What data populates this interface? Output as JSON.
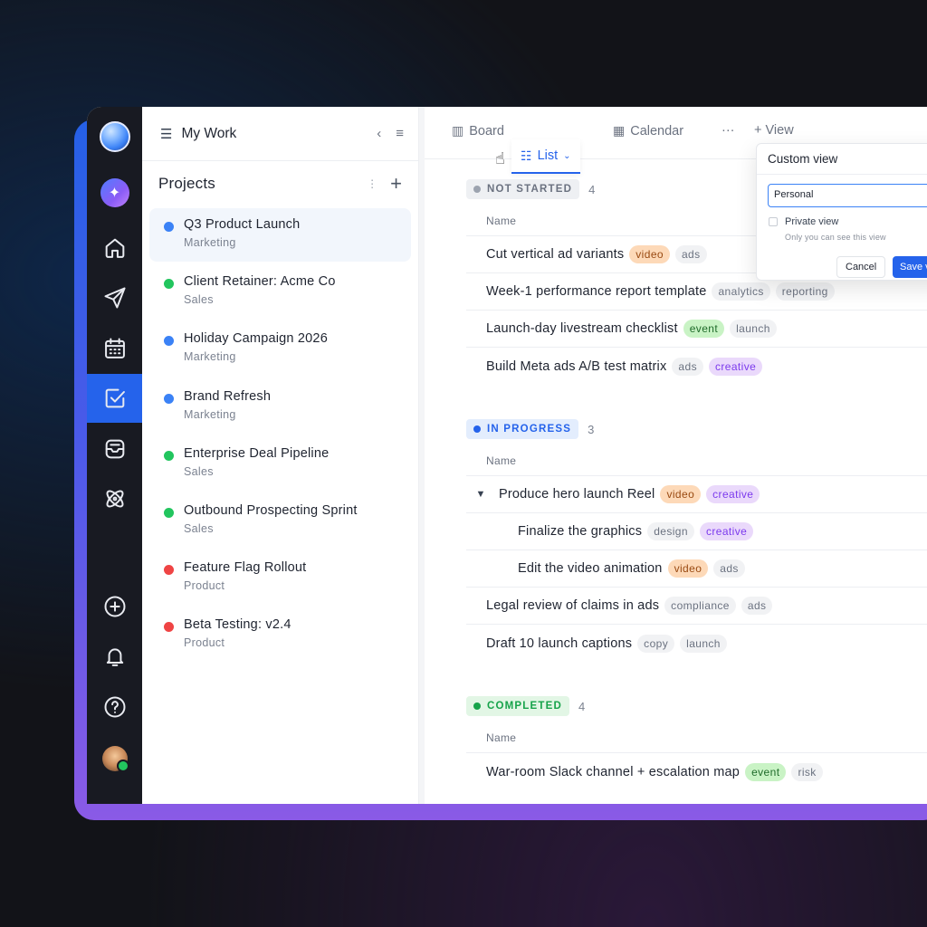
{
  "colors": {
    "accent": "#2563eb",
    "rail": "#181a22",
    "dot_blue": "#3b82f6",
    "dot_green": "#22c55e",
    "dot_red": "#ef4444"
  },
  "rail": {
    "icons": [
      "app-logo",
      "ai-sparkle-icon",
      "home-icon",
      "send-icon",
      "calendar-icon",
      "tasks-check-icon",
      "inbox-icon",
      "atom-icon",
      "add-circle-icon",
      "bell-icon",
      "help-icon",
      "user-avatar"
    ]
  },
  "panel": {
    "title": "My Work",
    "projects_heading": "Projects",
    "projects": [
      {
        "name": "Q3 Product Launch",
        "team": "Marketing",
        "color": "#3b82f6",
        "selected": true
      },
      {
        "name": "Client Retainer: Acme Co",
        "team": "Sales",
        "color": "#22c55e"
      },
      {
        "name": "Holiday Campaign 2026",
        "team": "Marketing",
        "color": "#3b82f6"
      },
      {
        "name": "Brand Refresh",
        "team": "Marketing",
        "color": "#3b82f6"
      },
      {
        "name": "Enterprise Deal Pipeline",
        "team": "Sales",
        "color": "#22c55e"
      },
      {
        "name": "Outbound Prospecting Sprint",
        "team": "Sales",
        "color": "#22c55e"
      },
      {
        "name": "Feature Flag Rollout",
        "team": "Product",
        "color": "#ef4444"
      },
      {
        "name": "Beta Testing: v2.4",
        "team": "Product",
        "color": "#ef4444"
      }
    ]
  },
  "views": {
    "board": "Board",
    "list": "List",
    "calendar": "Calendar",
    "more": "···",
    "add_view": "+ View"
  },
  "popover": {
    "title": "Custom view",
    "input_value": "Personal",
    "checkbox_label": "Private view",
    "hint": "Only you can see this view",
    "cancel": "Cancel",
    "save": "Save vi"
  },
  "groups": {
    "not_started": {
      "label": "NOT STARTED",
      "count": "4",
      "column": "Name",
      "rows": [
        {
          "name": "Cut vertical ad variants",
          "tags": [
            "video",
            "ads"
          ]
        },
        {
          "name": "Week-1 performance report template",
          "tags": [
            "analytics",
            "reporting"
          ]
        },
        {
          "name": "Launch-day livestream checklist",
          "tags": [
            "event",
            "launch"
          ]
        },
        {
          "name": "Build Meta ads A/B test matrix",
          "tags": [
            "ads",
            "creative"
          ]
        }
      ]
    },
    "in_progress": {
      "label": "IN PROGRESS",
      "count": "3",
      "column": "Name",
      "rows": [
        {
          "name": "Produce hero launch Reel",
          "tags": [
            "video",
            "creative"
          ]
        },
        {
          "name": "Finalize the graphics",
          "tags": [
            "design",
            "creative"
          ]
        },
        {
          "name": "Edit the video animation",
          "tags": [
            "video",
            "ads"
          ]
        },
        {
          "name": "Legal review of claims in ads",
          "tags": [
            "compliance",
            "ads"
          ]
        },
        {
          "name": "Draft 10 launch captions",
          "tags": [
            "copy",
            "launch"
          ]
        }
      ]
    },
    "completed": {
      "label": "COMPLETED",
      "count": "4",
      "column": "Name",
      "rows": [
        {
          "name": "War-room Slack channel + escalation map",
          "tags": [
            "event",
            "risk"
          ]
        }
      ]
    }
  },
  "tag_styles": {
    "video": {
      "bg": "#fdd9b8",
      "fg": "#9a4a12"
    },
    "event": {
      "bg": "#c9f3c5",
      "fg": "#1f6b2a"
    },
    "creative": {
      "bg": "#ead9fb",
      "fg": "#7c3aed"
    },
    "default": {
      "bg": "#f1f2f4",
      "fg": "#6b7280"
    }
  }
}
